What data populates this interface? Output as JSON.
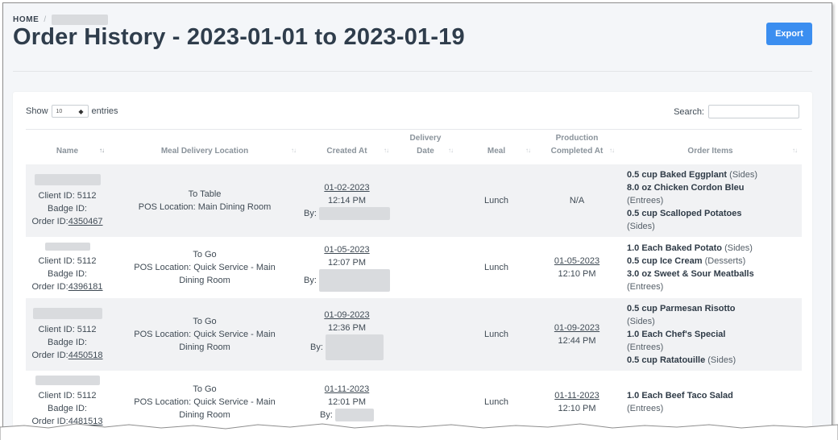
{
  "breadcrumb": {
    "home": "HOME",
    "separator": "/"
  },
  "page_title": "Order History - 2023-01-01 to 2023-01-19",
  "export_label": "Export",
  "table_controls": {
    "show_label": "Show",
    "entries_value": "10",
    "entries_label": "entries",
    "search_label": "Search:",
    "search_value": ""
  },
  "columns": {
    "name": "Name",
    "location": "Meal Delivery Location",
    "created": "Created At",
    "delivery_line1": "Delivery",
    "delivery_line2": "Date",
    "meal": "Meal",
    "production_line1": "Production",
    "production_line2": "Completed At",
    "items": "Order Items"
  },
  "rows": [
    {
      "client_id": "Client ID: 5112",
      "badge_id": "Badge ID:",
      "order_prefix": "Order ID:",
      "order_id": "4350467",
      "location_line1": "To Table",
      "location_line2": "POS Location: Main Dining Room",
      "location_line3": "",
      "created_date": "01-02-2023",
      "created_time": "12:14 PM",
      "created_by": "By:",
      "meal": "Lunch",
      "production": "N/A",
      "production_date": "",
      "production_time": "",
      "items": [
        {
          "name": "0.5 cup Baked Eggplant",
          "category": "(Sides)"
        },
        {
          "name": "8.0 oz Chicken Cordon Bleu",
          "category": "(Entrees)"
        },
        {
          "name": "0.5 cup Scalloped Potatoes",
          "category": "(Sides)"
        }
      ]
    },
    {
      "client_id": "Client ID: 5112",
      "badge_id": "Badge ID:",
      "order_prefix": "Order ID:",
      "order_id": "4396181",
      "location_line1": "To Go",
      "location_line2": "POS Location: Quick Service - Main",
      "location_line3": "Dining Room",
      "created_date": "01-05-2023",
      "created_time": "12:07 PM",
      "created_by": "By:",
      "meal": "Lunch",
      "production": "",
      "production_date": "01-05-2023",
      "production_time": "12:10 PM",
      "items": [
        {
          "name": "1.0 Each Baked Potato",
          "category": "(Sides)"
        },
        {
          "name": "0.5 cup Ice Cream",
          "category": "(Desserts)"
        },
        {
          "name": "3.0 oz Sweet & Sour Meatballs",
          "category": "(Entrees)"
        }
      ]
    },
    {
      "client_id": "Client ID: 5112",
      "badge_id": "Badge ID:",
      "order_prefix": "Order ID:",
      "order_id": "4450518",
      "location_line1": "To Go",
      "location_line2": "POS Location: Quick Service - Main",
      "location_line3": "Dining Room",
      "created_date": "01-09-2023",
      "created_time": "12:36 PM",
      "created_by": "By:",
      "meal": "Lunch",
      "production": "",
      "production_date": "01-09-2023",
      "production_time": "12:44 PM",
      "items": [
        {
          "name": "0.5 cup Parmesan Risotto",
          "category": "(Sides)"
        },
        {
          "name": "1.0 Each Chef's Special",
          "category": "(Entrees)"
        },
        {
          "name": "0.5 cup Ratatouille",
          "category": "(Sides)"
        }
      ]
    },
    {
      "client_id": "Client ID: 5112",
      "badge_id": "Badge ID:",
      "order_prefix": "Order ID:",
      "order_id": "4481513",
      "location_line1": "To Go",
      "location_line2": "POS Location: Quick Service - Main",
      "location_line3": "Dining Room",
      "created_date": "01-11-2023",
      "created_time": "12:01 PM",
      "created_by": "By:",
      "meal": "Lunch",
      "production": "",
      "production_date": "01-11-2023",
      "production_time": "12:10 PM",
      "items": [
        {
          "name": "1.0 Each Beef Taco Salad",
          "category": "(Entrees)"
        }
      ]
    }
  ]
}
